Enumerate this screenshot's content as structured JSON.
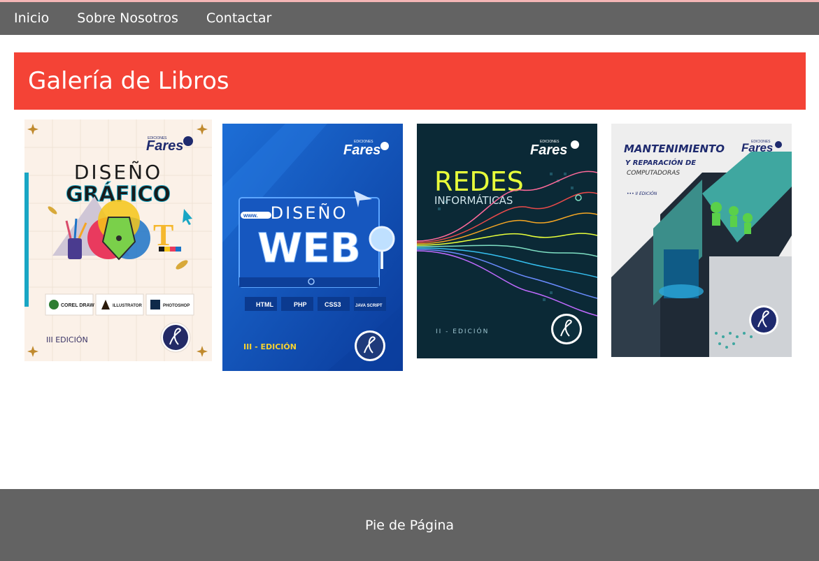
{
  "nav": {
    "items": [
      {
        "label": "Inicio"
      },
      {
        "label": "Sobre Nosotros"
      },
      {
        "label": "Contactar"
      }
    ]
  },
  "header": {
    "title": "Galería de Libros"
  },
  "books": [
    {
      "publisher": "Fares",
      "publisher_small": "EDICIONES",
      "title_line1": "DISEÑO",
      "title_line2": "GRÁFICO",
      "apps": [
        "COREL DRAW",
        "ILLUSTRATOR",
        "PHOTOSHOP"
      ],
      "edition": "III EDICIÓN"
    },
    {
      "publisher": "Fares",
      "publisher_small": "EDICIONES",
      "title_line1": "DISEÑO",
      "title_line2": "WEB",
      "url_text": "www.",
      "tags": [
        "HTML",
        "PHP",
        "CSS3",
        "JAVA SCRIPT"
      ],
      "edition": "III - EDICIÓN"
    },
    {
      "publisher": "Fares",
      "publisher_small": "EDICIONES",
      "title_line1": "REDES",
      "title_line2": "INFORMÁTICAS",
      "edition": "II - EDICIÓN"
    },
    {
      "publisher": "Fares",
      "publisher_small": "EDICIONES",
      "title_line1": "MANTENIMIENTO",
      "title_line2": "Y REPARACIÓN DE",
      "title_line3": "COMPUTADORAS",
      "edition": "••• II EDICIÓN"
    }
  ],
  "footer": {
    "text": "Pie de Página"
  },
  "colors": {
    "nav_bg": "#636363",
    "banner_bg": "#f44336",
    "footer_bg": "#636363"
  }
}
